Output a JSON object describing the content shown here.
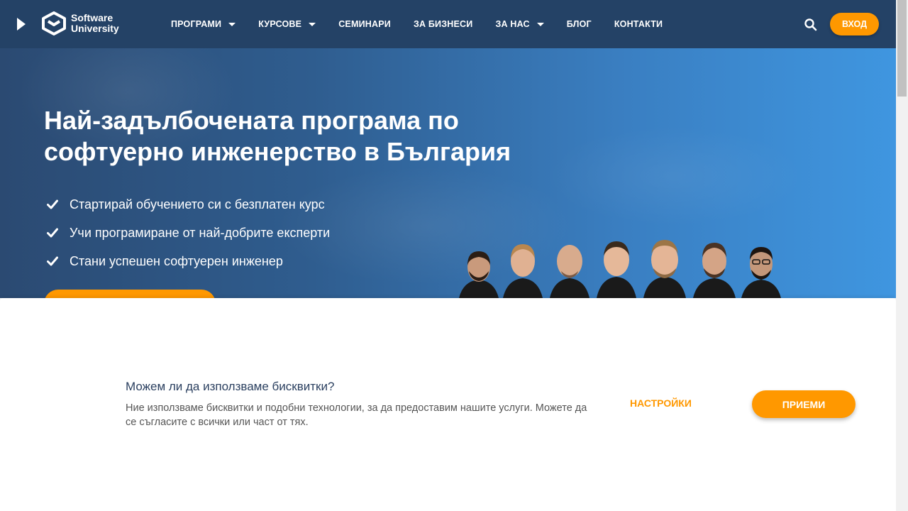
{
  "header": {
    "logo": {
      "line1": "Software",
      "line2": "University"
    },
    "nav": [
      {
        "label": "ПРОГРАМИ",
        "has_dropdown": true
      },
      {
        "label": "КУРСОВЕ",
        "has_dropdown": true
      },
      {
        "label": "СЕМИНАРИ",
        "has_dropdown": false
      },
      {
        "label": "ЗА БИЗНЕСИ",
        "has_dropdown": false
      },
      {
        "label": "ЗА НАС",
        "has_dropdown": true
      },
      {
        "label": "БЛОГ",
        "has_dropdown": false
      },
      {
        "label": "КОНТАКТИ",
        "has_dropdown": false
      }
    ],
    "search_icon": "search-icon",
    "login_label": "ВХОД"
  },
  "hero": {
    "title": "Най-задълбочената програма по софтуерно инженерство в България",
    "bullets": [
      "Стартирай обучението си с безплатен курс",
      "Учи програмиране от най-добрите експерти",
      "Стани успешен софтуерен инженер"
    ]
  },
  "cookie_banner": {
    "title": "Можем ли да използваме бисквитки?",
    "text": "Ние използваме бисквитки и подобни технологии, за да предоставим нашите услуги. Можете да се съгласите с всички или част от тях.",
    "settings_label": "НАСТРОЙКИ",
    "accept_label": "ПРИЕМИ"
  },
  "colors": {
    "header_bg": "#244266",
    "accent": "#ff9800",
    "hero_gradient_start": "#2b4a72",
    "hero_gradient_end": "#3f96e0"
  }
}
